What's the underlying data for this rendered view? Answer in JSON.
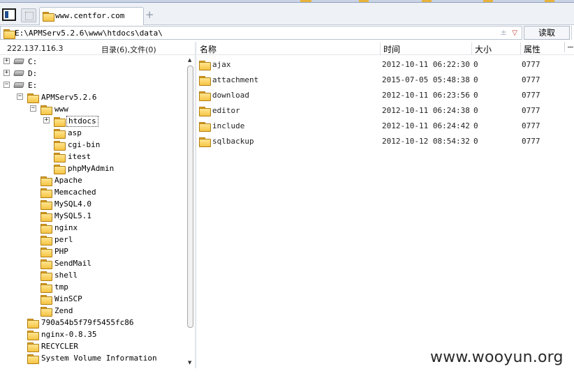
{
  "tabs": [
    {
      "label": "www.centfor.com",
      "active": true
    }
  ],
  "tab_plus": "+",
  "address": {
    "path": "E:\\APMServ5.2.6\\www\\htdocs\\data\\",
    "pm": "±",
    "dropdown": "▽",
    "read_button": "读取"
  },
  "status": {
    "ip": "222.137.116.3",
    "counts": "目录(6),文件(0)"
  },
  "columns": {
    "name": "名称",
    "time": "时间",
    "size": "大小",
    "attr": "属性"
  },
  "tree": [
    {
      "label": "C:",
      "expander": "+",
      "kind": "drive",
      "level": 0
    },
    {
      "label": "D:",
      "expander": "+",
      "kind": "drive",
      "level": 0
    },
    {
      "label": "E:",
      "expander": "−",
      "kind": "drive",
      "level": 0
    },
    {
      "label": "APMServ5.2.6",
      "expander": "−",
      "kind": "folder",
      "level": 1
    },
    {
      "label": "www",
      "expander": "−",
      "kind": "folder",
      "level": 2
    },
    {
      "label": "htdocs",
      "expander": "+",
      "kind": "folder",
      "level": 3,
      "selected": true
    },
    {
      "label": "asp",
      "expander": "",
      "kind": "folder",
      "level": 3
    },
    {
      "label": "cgi-bin",
      "expander": "",
      "kind": "folder",
      "level": 3
    },
    {
      "label": "itest",
      "expander": "",
      "kind": "folder",
      "level": 3
    },
    {
      "label": "phpMyAdmin",
      "expander": "",
      "kind": "folder",
      "level": 3
    },
    {
      "label": "Apache",
      "expander": "",
      "kind": "folder",
      "level": 2
    },
    {
      "label": "Memcached",
      "expander": "",
      "kind": "folder",
      "level": 2
    },
    {
      "label": "MySQL4.0",
      "expander": "",
      "kind": "folder",
      "level": 2
    },
    {
      "label": "MySQL5.1",
      "expander": "",
      "kind": "folder",
      "level": 2
    },
    {
      "label": "nginx",
      "expander": "",
      "kind": "folder",
      "level": 2
    },
    {
      "label": "perl",
      "expander": "",
      "kind": "folder",
      "level": 2
    },
    {
      "label": "PHP",
      "expander": "",
      "kind": "folder",
      "level": 2
    },
    {
      "label": "SendMail",
      "expander": "",
      "kind": "folder",
      "level": 2
    },
    {
      "label": "shell",
      "expander": "",
      "kind": "folder",
      "level": 2
    },
    {
      "label": "tmp",
      "expander": "",
      "kind": "folder",
      "level": 2
    },
    {
      "label": "WinSCP",
      "expander": "",
      "kind": "folder",
      "level": 2
    },
    {
      "label": "Zend",
      "expander": "",
      "kind": "folder",
      "level": 2
    },
    {
      "label": "790a54b5f79f5455fc86",
      "expander": "",
      "kind": "folder",
      "level": 1
    },
    {
      "label": "nginx-0.8.35",
      "expander": "",
      "kind": "folder",
      "level": 1
    },
    {
      "label": "RECYCLER",
      "expander": "",
      "kind": "folder",
      "level": 1
    },
    {
      "label": "System Volume Information",
      "expander": "",
      "kind": "folder",
      "level": 1
    }
  ],
  "scroll": {
    "up": "▲",
    "down": "▼"
  },
  "files": [
    {
      "name": "ajax",
      "time": "2012-10-11 06:22:30",
      "size": "0",
      "attr": "0777"
    },
    {
      "name": "attachment",
      "time": "2015-07-05 05:48:38",
      "size": "0",
      "attr": "0777"
    },
    {
      "name": "download",
      "time": "2012-10-11 06:23:56",
      "size": "0",
      "attr": "0777"
    },
    {
      "name": "editor",
      "time": "2012-10-11 06:24:38",
      "size": "0",
      "attr": "0777"
    },
    {
      "name": "include",
      "time": "2012-10-11 06:24:42",
      "size": "0",
      "attr": "0777"
    },
    {
      "name": "sqlbackup",
      "time": "2012-10-12 08:54:32",
      "size": "0",
      "attr": "0777"
    }
  ],
  "watermark": "www.wooyun.org"
}
